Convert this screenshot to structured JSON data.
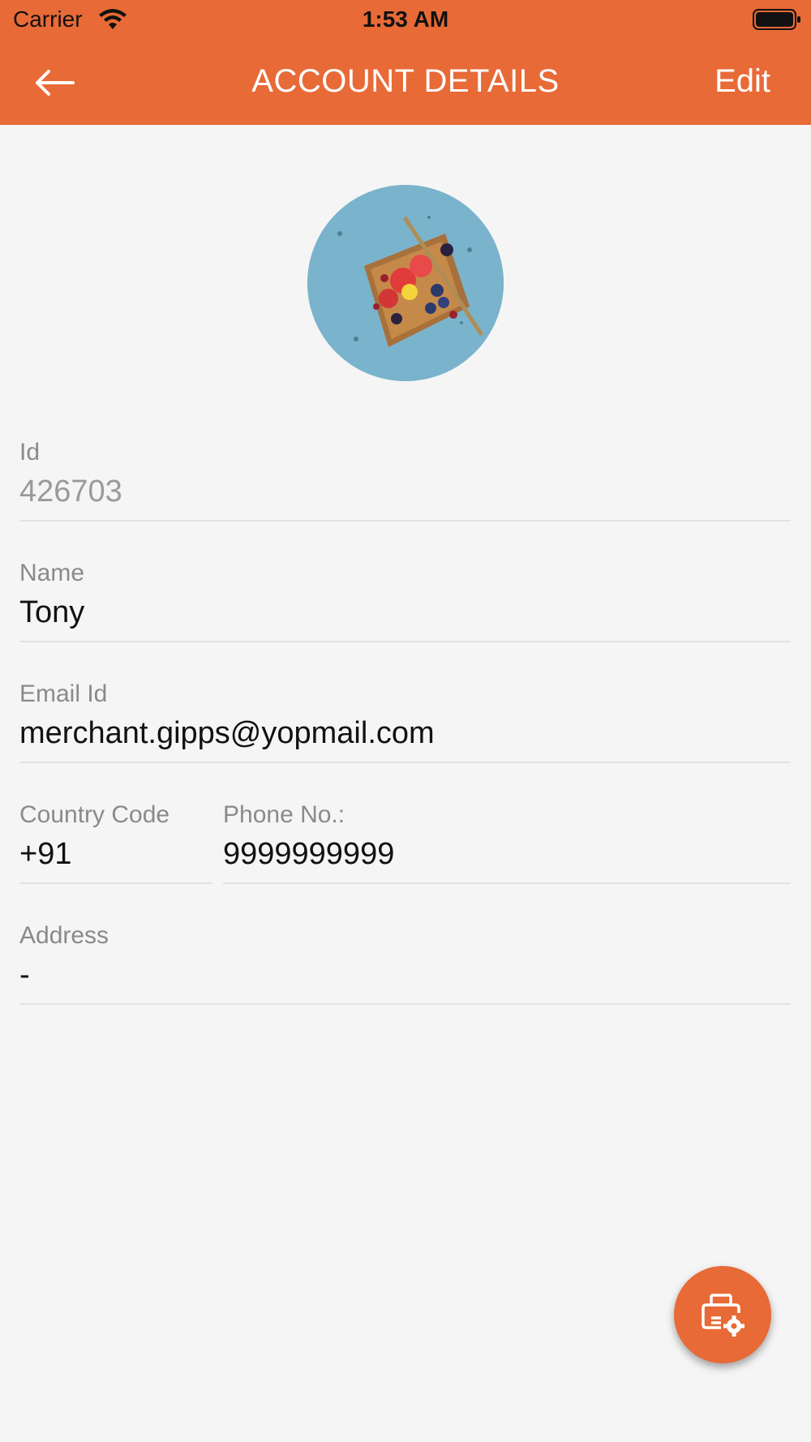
{
  "status_bar": {
    "carrier": "Carrier",
    "time": "1:53 AM"
  },
  "header": {
    "title": "ACCOUNT DETAILS",
    "edit_label": "Edit",
    "back_icon": "arrow-left-icon"
  },
  "colors": {
    "accent": "#e86a37",
    "background": "#f5f5f5"
  },
  "profile": {
    "avatar_image": "food plate with toast, berries and fork"
  },
  "fields": {
    "id": {
      "label": "Id",
      "value": "426703"
    },
    "name": {
      "label": "Name",
      "value": "Tony"
    },
    "email": {
      "label": "Email Id",
      "value": "merchant.gipps@yopmail.com"
    },
    "country_code": {
      "label": "Country Code",
      "value": "+91"
    },
    "phone": {
      "label": "Phone No.:",
      "value": "9999999999"
    },
    "address": {
      "label": "Address",
      "value": "-"
    }
  },
  "fab": {
    "icon": "printer-settings-icon"
  }
}
